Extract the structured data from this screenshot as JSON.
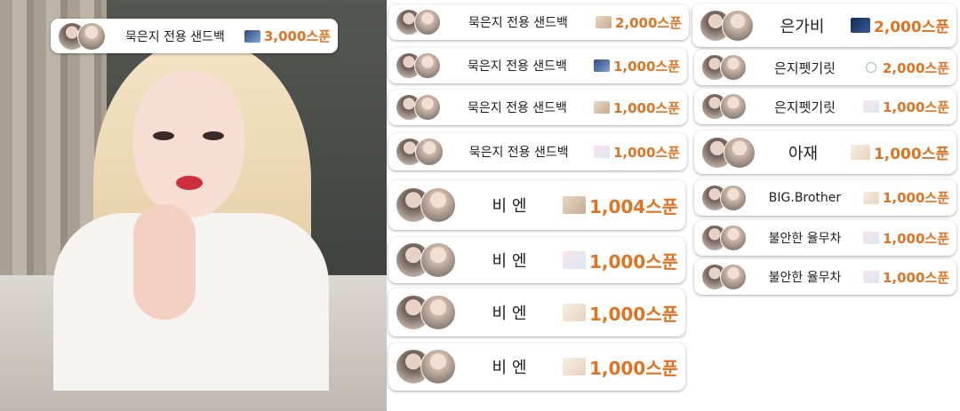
{
  "colors": {
    "amount": "#e07322",
    "name": "#1d1d1d",
    "pill_bg": "#ffffff"
  },
  "overlay_badge": {
    "name": "묵은지 전용 샌드백",
    "amount": "3,000스푼",
    "gift_icon": "sky-photo-gift-icon"
  },
  "donations_left": [
    {
      "name": "묵은지 전용 샌드백",
      "amount": "2,000스푼",
      "gift_icon": "beige-gift-icon"
    },
    {
      "name": "묵은지 전용 샌드백",
      "amount": "1,000스푼",
      "gift_icon": "sky-gift-icon"
    },
    {
      "name": "묵은지 전용 샌드백",
      "amount": "1,000스푼",
      "gift_icon": "frame-gift-icon"
    },
    {
      "name": "묵은지 전용 샌드백",
      "amount": "1,000스푼",
      "gift_icon": "flower-gift-icon"
    },
    {
      "name": "비 엔",
      "amount": "1,004스푼",
      "gift_icon": "hands-gift-icon"
    },
    {
      "name": "비 엔",
      "amount": "1,000스푼",
      "gift_icon": "cloud-gift-icon"
    },
    {
      "name": "비 엔",
      "amount": "1,000스푼",
      "gift_icon": "text-gift-icon"
    },
    {
      "name": "비 엔",
      "amount": "1,000스푼",
      "gift_icon": "note-gift-icon"
    }
  ],
  "donations_right": [
    {
      "name": "은가비",
      "amount": "2,000스푼",
      "gift_icon": "night-sky-gift-icon"
    },
    {
      "name": "은지펫기릿",
      "amount": "2,000스푼",
      "gift_icon": "ring-gift-icon"
    },
    {
      "name": "은지펫기릿",
      "amount": "1,000스푼",
      "gift_icon": "flower-gift-icon"
    },
    {
      "name": "아재",
      "amount": "1,000스푼",
      "gift_icon": "note-gift-icon"
    },
    {
      "name": "BIG.Brother",
      "amount": "1,000스푼",
      "gift_icon": "note-gift-icon"
    },
    {
      "name": "불안한 율무차",
      "amount": "1,000스푼",
      "gift_icon": "moon-gift-icon"
    },
    {
      "name": "불안한 율무차",
      "amount": "1,000스푼",
      "gift_icon": "flower-gift-icon"
    }
  ]
}
